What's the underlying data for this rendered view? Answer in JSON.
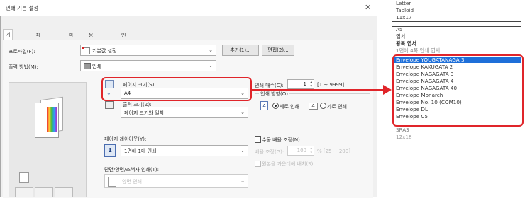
{
  "dialog": {
    "title": "인쇄 기본 설정",
    "close_glyph": "✕",
    "tabs": [
      "기본 설정",
      "페이지 설정",
      "마무리",
      "용지 공급원",
      "인쇄 품질"
    ]
  },
  "profile": {
    "label": "프로파일(F):",
    "value": "기본값 설정",
    "add_button": "추가(1)...",
    "edit_button": "편집(2)..."
  },
  "output_method": {
    "label": "출력 방법(M):",
    "value": "인쇄"
  },
  "page_size": {
    "label": "페이지 크기(S):",
    "value": "A4"
  },
  "output_size": {
    "label": "출력 크기(Z):",
    "value": "페이지 크기와 일치"
  },
  "copies": {
    "label": "인쇄 매수(C):",
    "value": "1",
    "range": "[1 ~ 9999]"
  },
  "orientation": {
    "label": "인쇄 방향(O)",
    "portrait": "세로 인쇄",
    "landscape": "가로 인쇄",
    "portrait_icon_letter": "A",
    "landscape_icon_letter": "A"
  },
  "page_layout": {
    "label": "페이지 레이아웃(Y):",
    "value": "1면에 1매 인쇄",
    "icon_number": "1"
  },
  "manual_scaling": {
    "label": "수동 배율 조정(N)",
    "scale_label": "배율 조정(G):",
    "scale_value": "100",
    "scale_range": "% [25 ~ 200]"
  },
  "print_border": {
    "label": "원본을 가운데에 배치(S)"
  },
  "duplex": {
    "label": "단면/양면/소책자 인쇄(T):",
    "value": "양면 인쇄"
  },
  "size_list_top": [
    "Letter",
    "Tabloid",
    "11x17",
    "A5",
    "엽서",
    "왕복 엽서",
    "1면에 4쪽 인쇄 엽서"
  ],
  "size_list": [
    "Envelope YOUGATANAGA 3",
    "Envelope KAKUGATA 2",
    "Envelope NAGAGATA 3",
    "Envelope NAGAGATA 4",
    "Envelope NAGAGATA 40",
    "Envelope Monarch",
    "Envelope No. 10 (COM10)",
    "Envelope DL",
    "Envelope C5"
  ],
  "size_list_bottom": [
    "SRA3",
    "12x18"
  ],
  "colors": {
    "highlight": "#e0252a",
    "selection": "#1e6fd9"
  }
}
